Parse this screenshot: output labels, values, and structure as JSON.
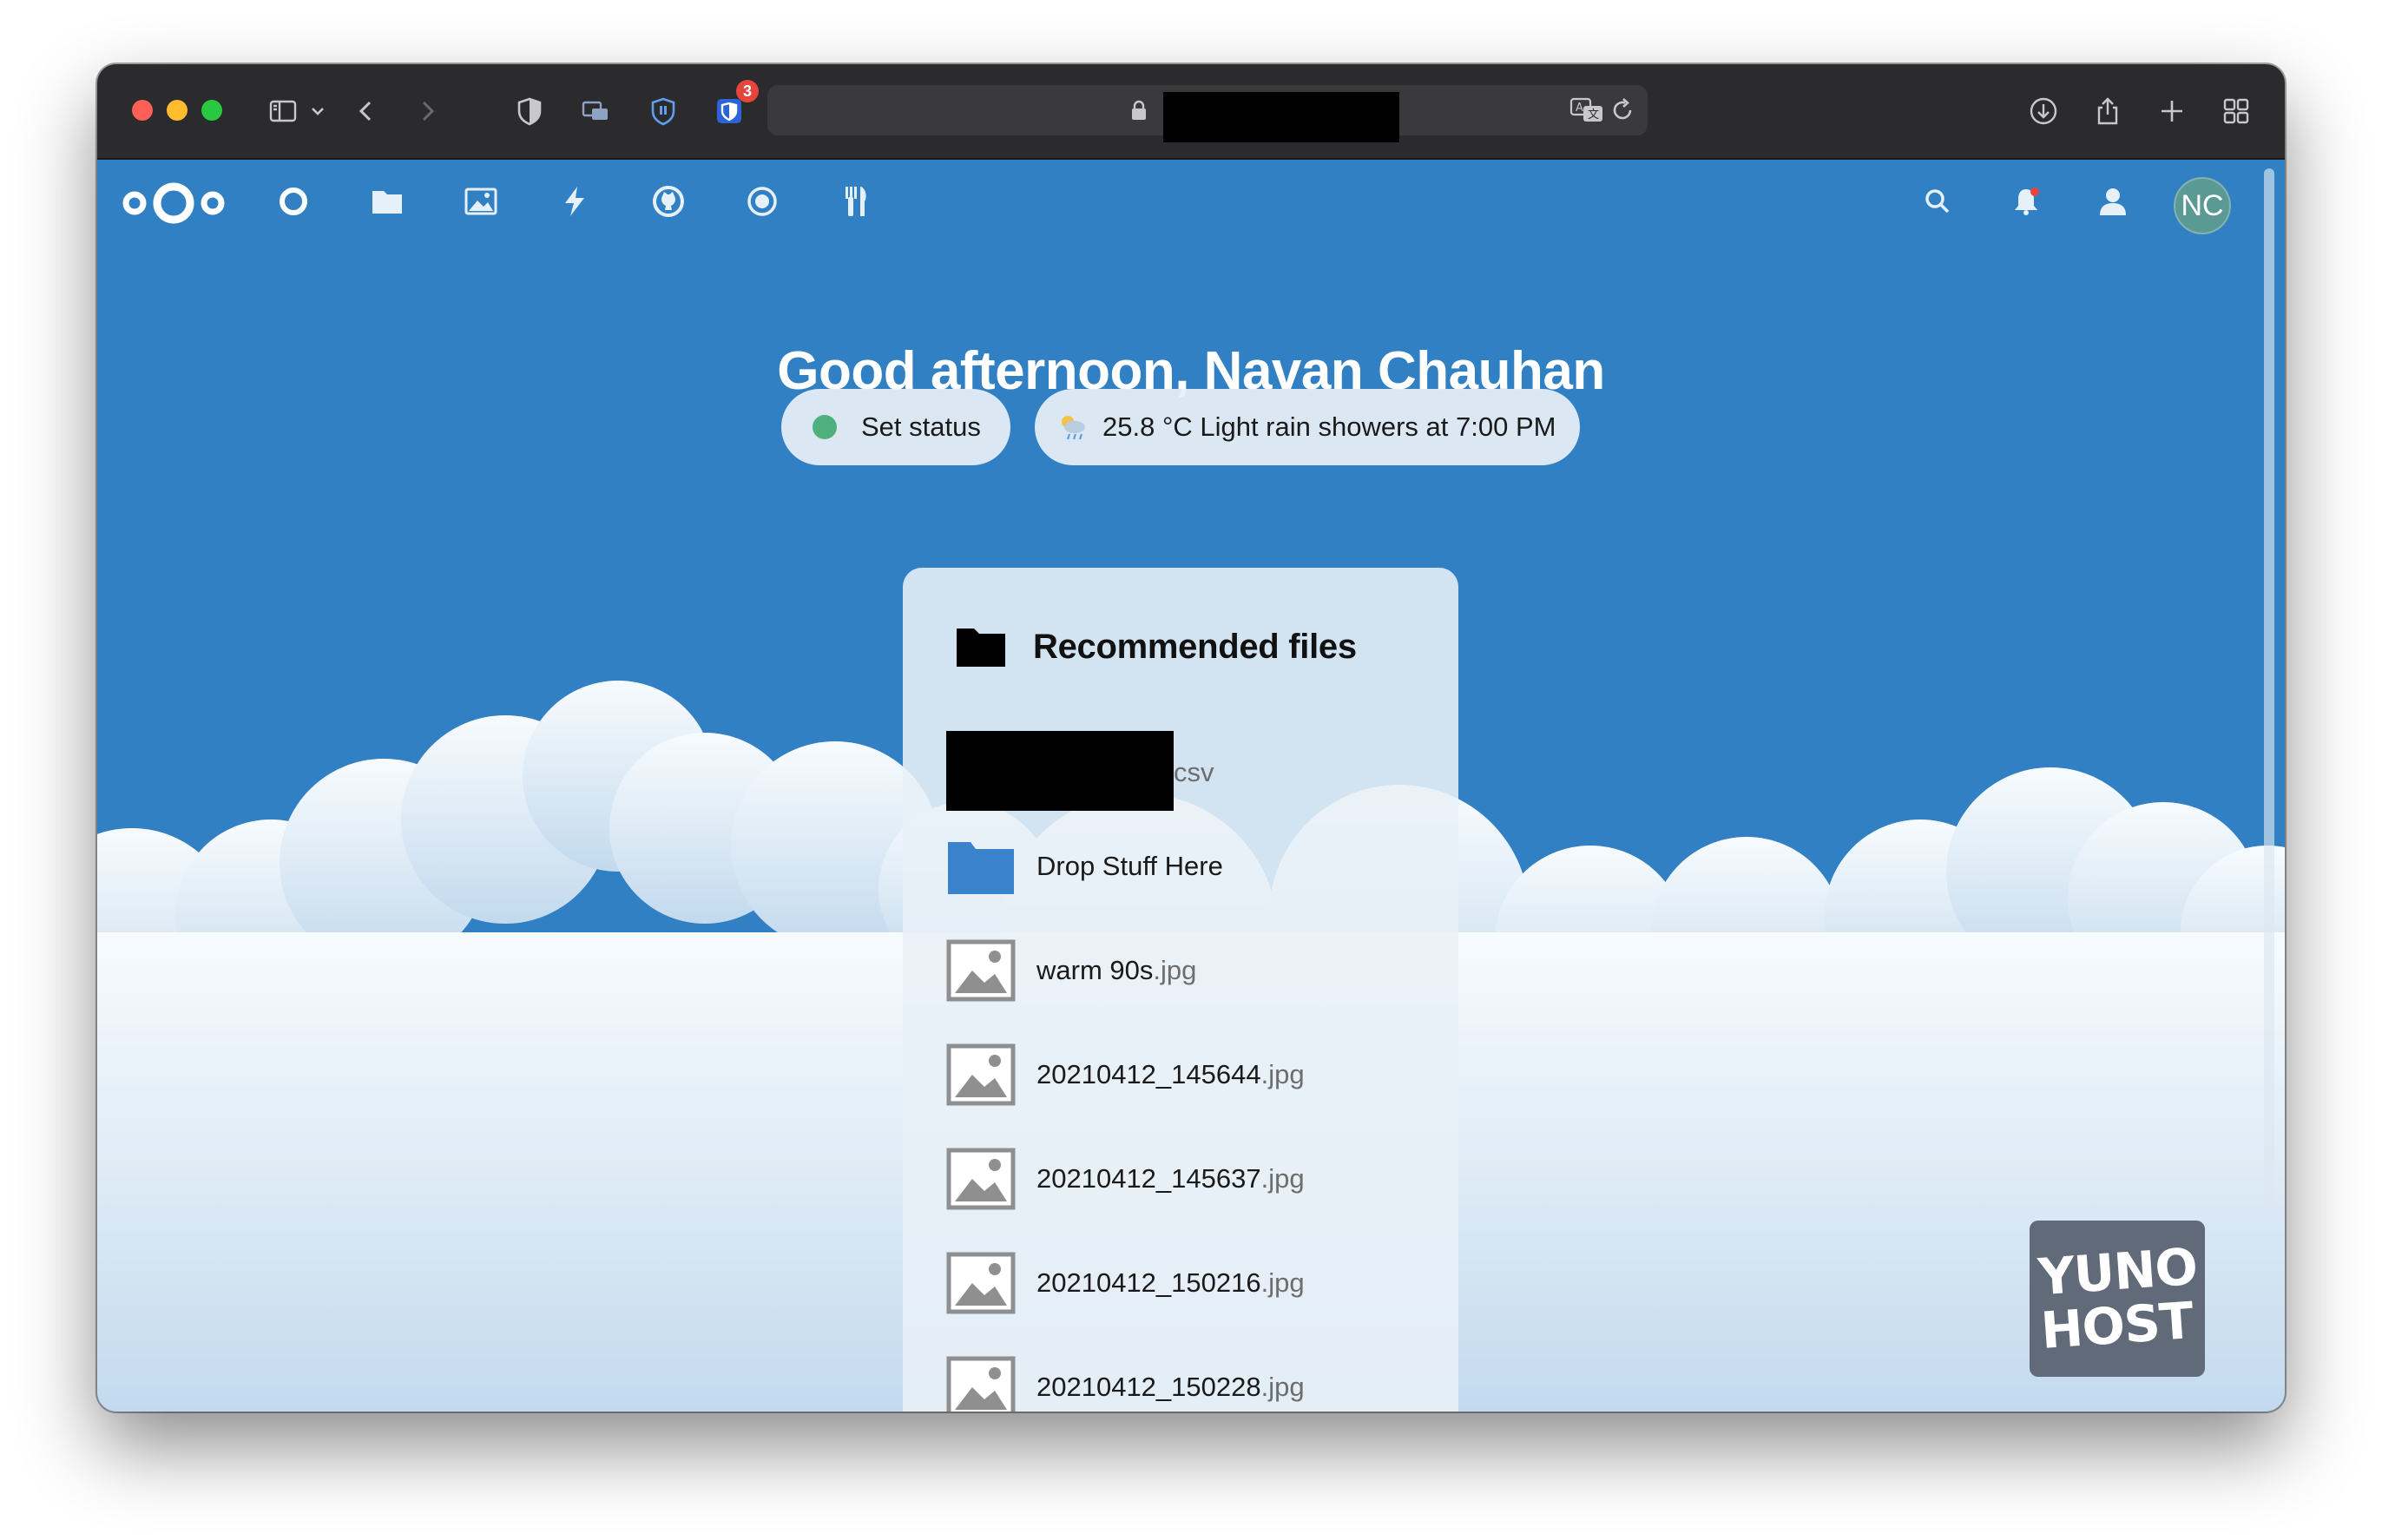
{
  "browser": {
    "url_redacted": true,
    "bitwarden_badge_count": "3"
  },
  "nextcloud": {
    "apps": [
      "dashboard-icon",
      "files-icon",
      "photos-icon",
      "activity-icon",
      "github-icon",
      "circles-icon",
      "cookbook-icon"
    ],
    "avatar_initials": "NC"
  },
  "greeting": "Good afternoon, Navan Chauhan",
  "status": {
    "label": "Set status",
    "color": "#4eb07d"
  },
  "weather": {
    "label": "25.8 °C Light rain showers at 7:00 PM"
  },
  "recommended": {
    "title": "Recommended files",
    "files": [
      {
        "name": "",
        "ext": "csv",
        "type": "redacted"
      },
      {
        "name": "Drop Stuff Here",
        "ext": "",
        "type": "folder"
      },
      {
        "name": "warm 90s",
        "ext": ".jpg",
        "type": "image"
      },
      {
        "name": "20210412_145644",
        "ext": ".jpg",
        "type": "image"
      },
      {
        "name": "20210412_145637",
        "ext": ".jpg",
        "type": "image"
      },
      {
        "name": "20210412_150216",
        "ext": ".jpg",
        "type": "image"
      },
      {
        "name": "20210412_150228",
        "ext": ".jpg",
        "type": "image"
      }
    ]
  },
  "yunohost": {
    "line1": "YUNO",
    "line2": "HOST"
  },
  "colors": {
    "background": "#3180c4",
    "toolbar": "#2b2a2d",
    "avatar": "#5b9a94",
    "folder": "#3b82cc"
  }
}
